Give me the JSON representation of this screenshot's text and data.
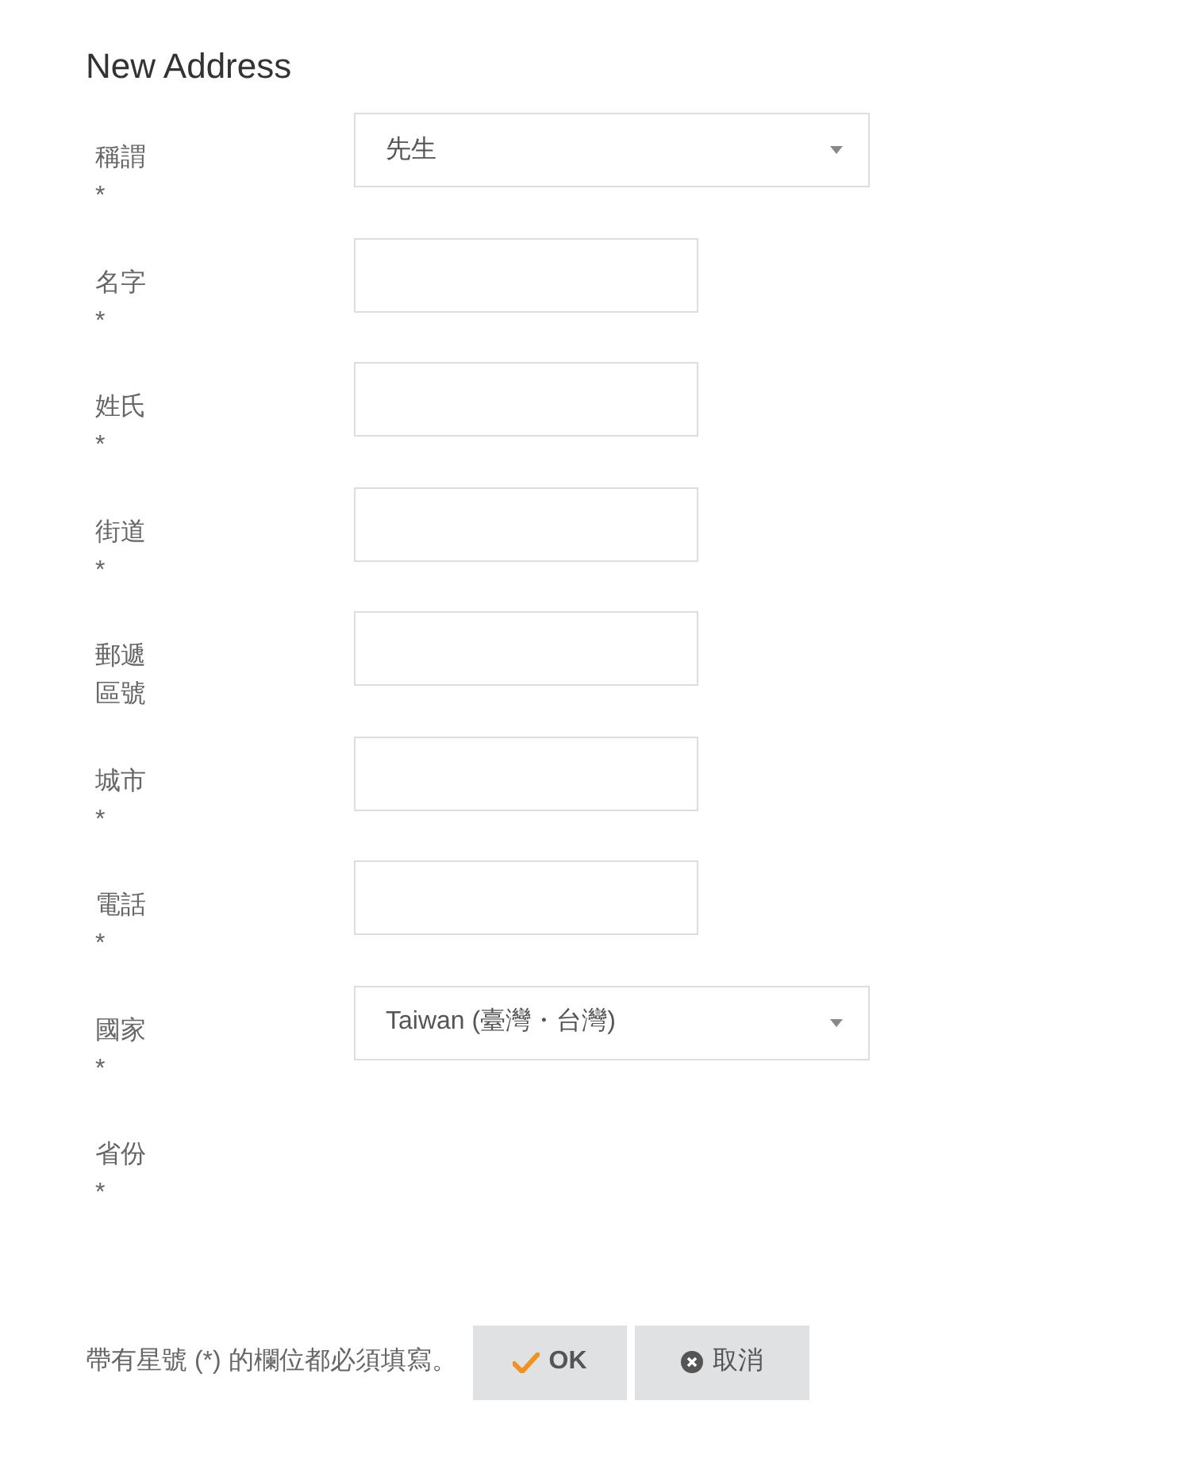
{
  "title": "New Address",
  "rows": [
    {
      "label": "稱謂",
      "mark": "*",
      "kind": "select",
      "value": "先生"
    },
    {
      "label": "名字",
      "mark": "*",
      "kind": "input"
    },
    {
      "label": "姓氏",
      "mark": "*",
      "kind": "input"
    },
    {
      "label": "街道",
      "mark": "*",
      "kind": "input"
    },
    {
      "label": "郵遞區號",
      "kind": "input"
    },
    {
      "label": "城市",
      "mark": "*",
      "kind": "input"
    },
    {
      "label": "電話",
      "mark": "*",
      "kind": "input"
    },
    {
      "label": "國家",
      "mark": "*",
      "kind": "select",
      "value": "Taiwan (臺灣・台灣)"
    },
    {
      "label": "省份",
      "mark": "*",
      "kind": "none"
    }
  ],
  "footer": {
    "note": "帶有星號 (*) 的欄位都必須填寫。",
    "buttons": [
      {
        "label": "OK",
        "kind": "ok"
      },
      {
        "label": "取消",
        "kind": "cancel"
      }
    ]
  }
}
